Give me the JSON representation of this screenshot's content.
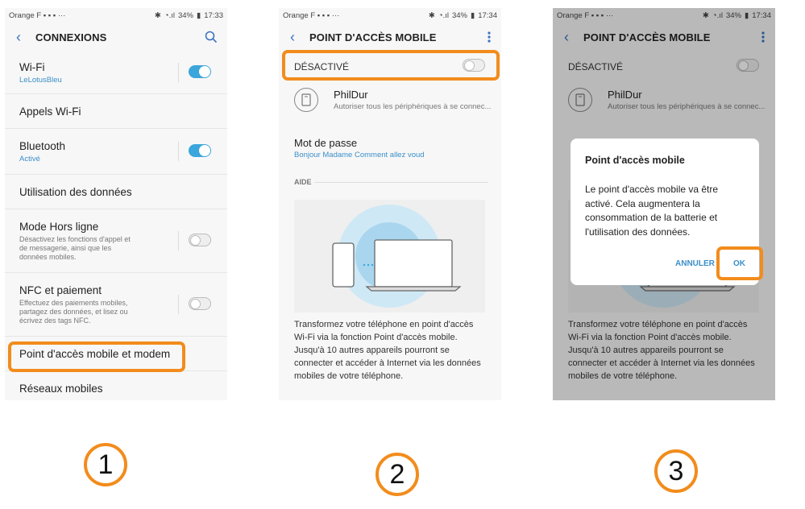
{
  "status1": {
    "carrier": "Orange F",
    "more": "···",
    "battery": "34%",
    "time": "17:33"
  },
  "status2": {
    "carrier": "Orange F",
    "more": "···",
    "battery": "34%",
    "time": "17:34"
  },
  "status3": {
    "carrier": "Orange F",
    "more": "···",
    "battery": "34%",
    "time": "17:34"
  },
  "s1": {
    "title": "CONNEXIONS",
    "wifi": {
      "label": "Wi-Fi",
      "sub": "LeLotusBleu"
    },
    "appels": {
      "label": "Appels Wi-Fi"
    },
    "bt": {
      "label": "Bluetooth",
      "sub": "Activé"
    },
    "donnees": {
      "label": "Utilisation des données"
    },
    "hors": {
      "label": "Mode Hors ligne",
      "desc": "Désactivez les fonctions d'appel et de messagerie, ainsi que les données mobiles."
    },
    "nfc": {
      "label": "NFC et paiement",
      "desc": "Effectuez des paiements mobiles, partagez des données, et lisez ou écrivez des tags NFC."
    },
    "point": {
      "label": "Point d'accès mobile et modem"
    },
    "reseaux": {
      "label": "Réseaux mobiles"
    }
  },
  "s2": {
    "title": "POINT D'ACCÈS MOBILE",
    "state": "DÉSACTIVÉ",
    "name": "PhilDur",
    "name_desc": "Autoriser tous les périphériques à se connec...",
    "pwd_label": "Mot de passe",
    "pwd_value": "Bonjour Madame Comment allez voud",
    "aide": "AIDE",
    "para": "Transformez votre téléphone en point d'accès Wi-Fi via la fonction Point d'accès mobile. Jusqu'à 10 autres appareils pourront se connecter et accéder à Internet via les données mobiles de votre téléphone."
  },
  "s3": {
    "title": "POINT D'ACCÈS MOBILE",
    "state": "DÉSACTIVÉ",
    "name": "PhilDur",
    "name_desc": "Autoriser tous les périphériques à se connec...",
    "para": "Transformez votre téléphone en point d'accès Wi-Fi via la fonction Point d'accès mobile. Jusqu'à 10 autres appareils pourront se connecter et accéder à Internet via les données mobiles de votre téléphone.",
    "dialog": {
      "title": "Point d'accès mobile",
      "body": "Le point d'accès mobile va être activé. Cela augmentera la consommation de la batterie et l'utilisation des données.",
      "cancel": "ANNULER",
      "ok": "OK"
    }
  },
  "steps": {
    "one": "1",
    "two": "2",
    "three": "3"
  },
  "colors": {
    "accent": "#f28c1c",
    "toggle_on": "#3aa6dc",
    "link": "#3b8fc9",
    "back": "#3b73c2"
  }
}
